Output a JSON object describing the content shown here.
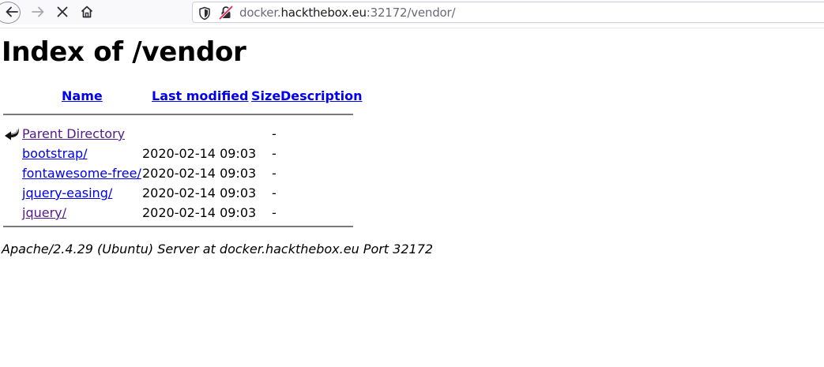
{
  "browser": {
    "url_prefix": "docker.",
    "url_host": "hackthebox.eu",
    "url_suffix": ":32172/vendor/",
    "icons": [
      "back-icon",
      "forward-icon",
      "stop-icon",
      "home-icon",
      "shield-icon",
      "insecure-lock-icon"
    ]
  },
  "page": {
    "title": "Index of /vendor",
    "columns": {
      "name": "Name",
      "last_modified": "Last modified",
      "size": "Size",
      "description": "Description"
    },
    "rows": [
      {
        "name": "Parent Directory",
        "modified": "",
        "size": "-",
        "icon": "back-arrow-icon"
      },
      {
        "name": "bootstrap/",
        "modified": "2020-02-14 09:03",
        "size": "-"
      },
      {
        "name": "fontawesome-free/",
        "modified": "2020-02-14 09:03",
        "size": "-"
      },
      {
        "name": "jquery-easing/",
        "modified": "2020-02-14 09:03",
        "size": "-"
      },
      {
        "name": "jquery/",
        "modified": "2020-02-14 09:03",
        "size": "-"
      }
    ],
    "footer": "Apache/2.4.29 (Ubuntu) Server at docker.hackthebox.eu Port 32172"
  },
  "colors": {
    "link": "#0000ee",
    "visited_link": "#551a8b",
    "toolbar_bg": "#f9f9fb"
  }
}
